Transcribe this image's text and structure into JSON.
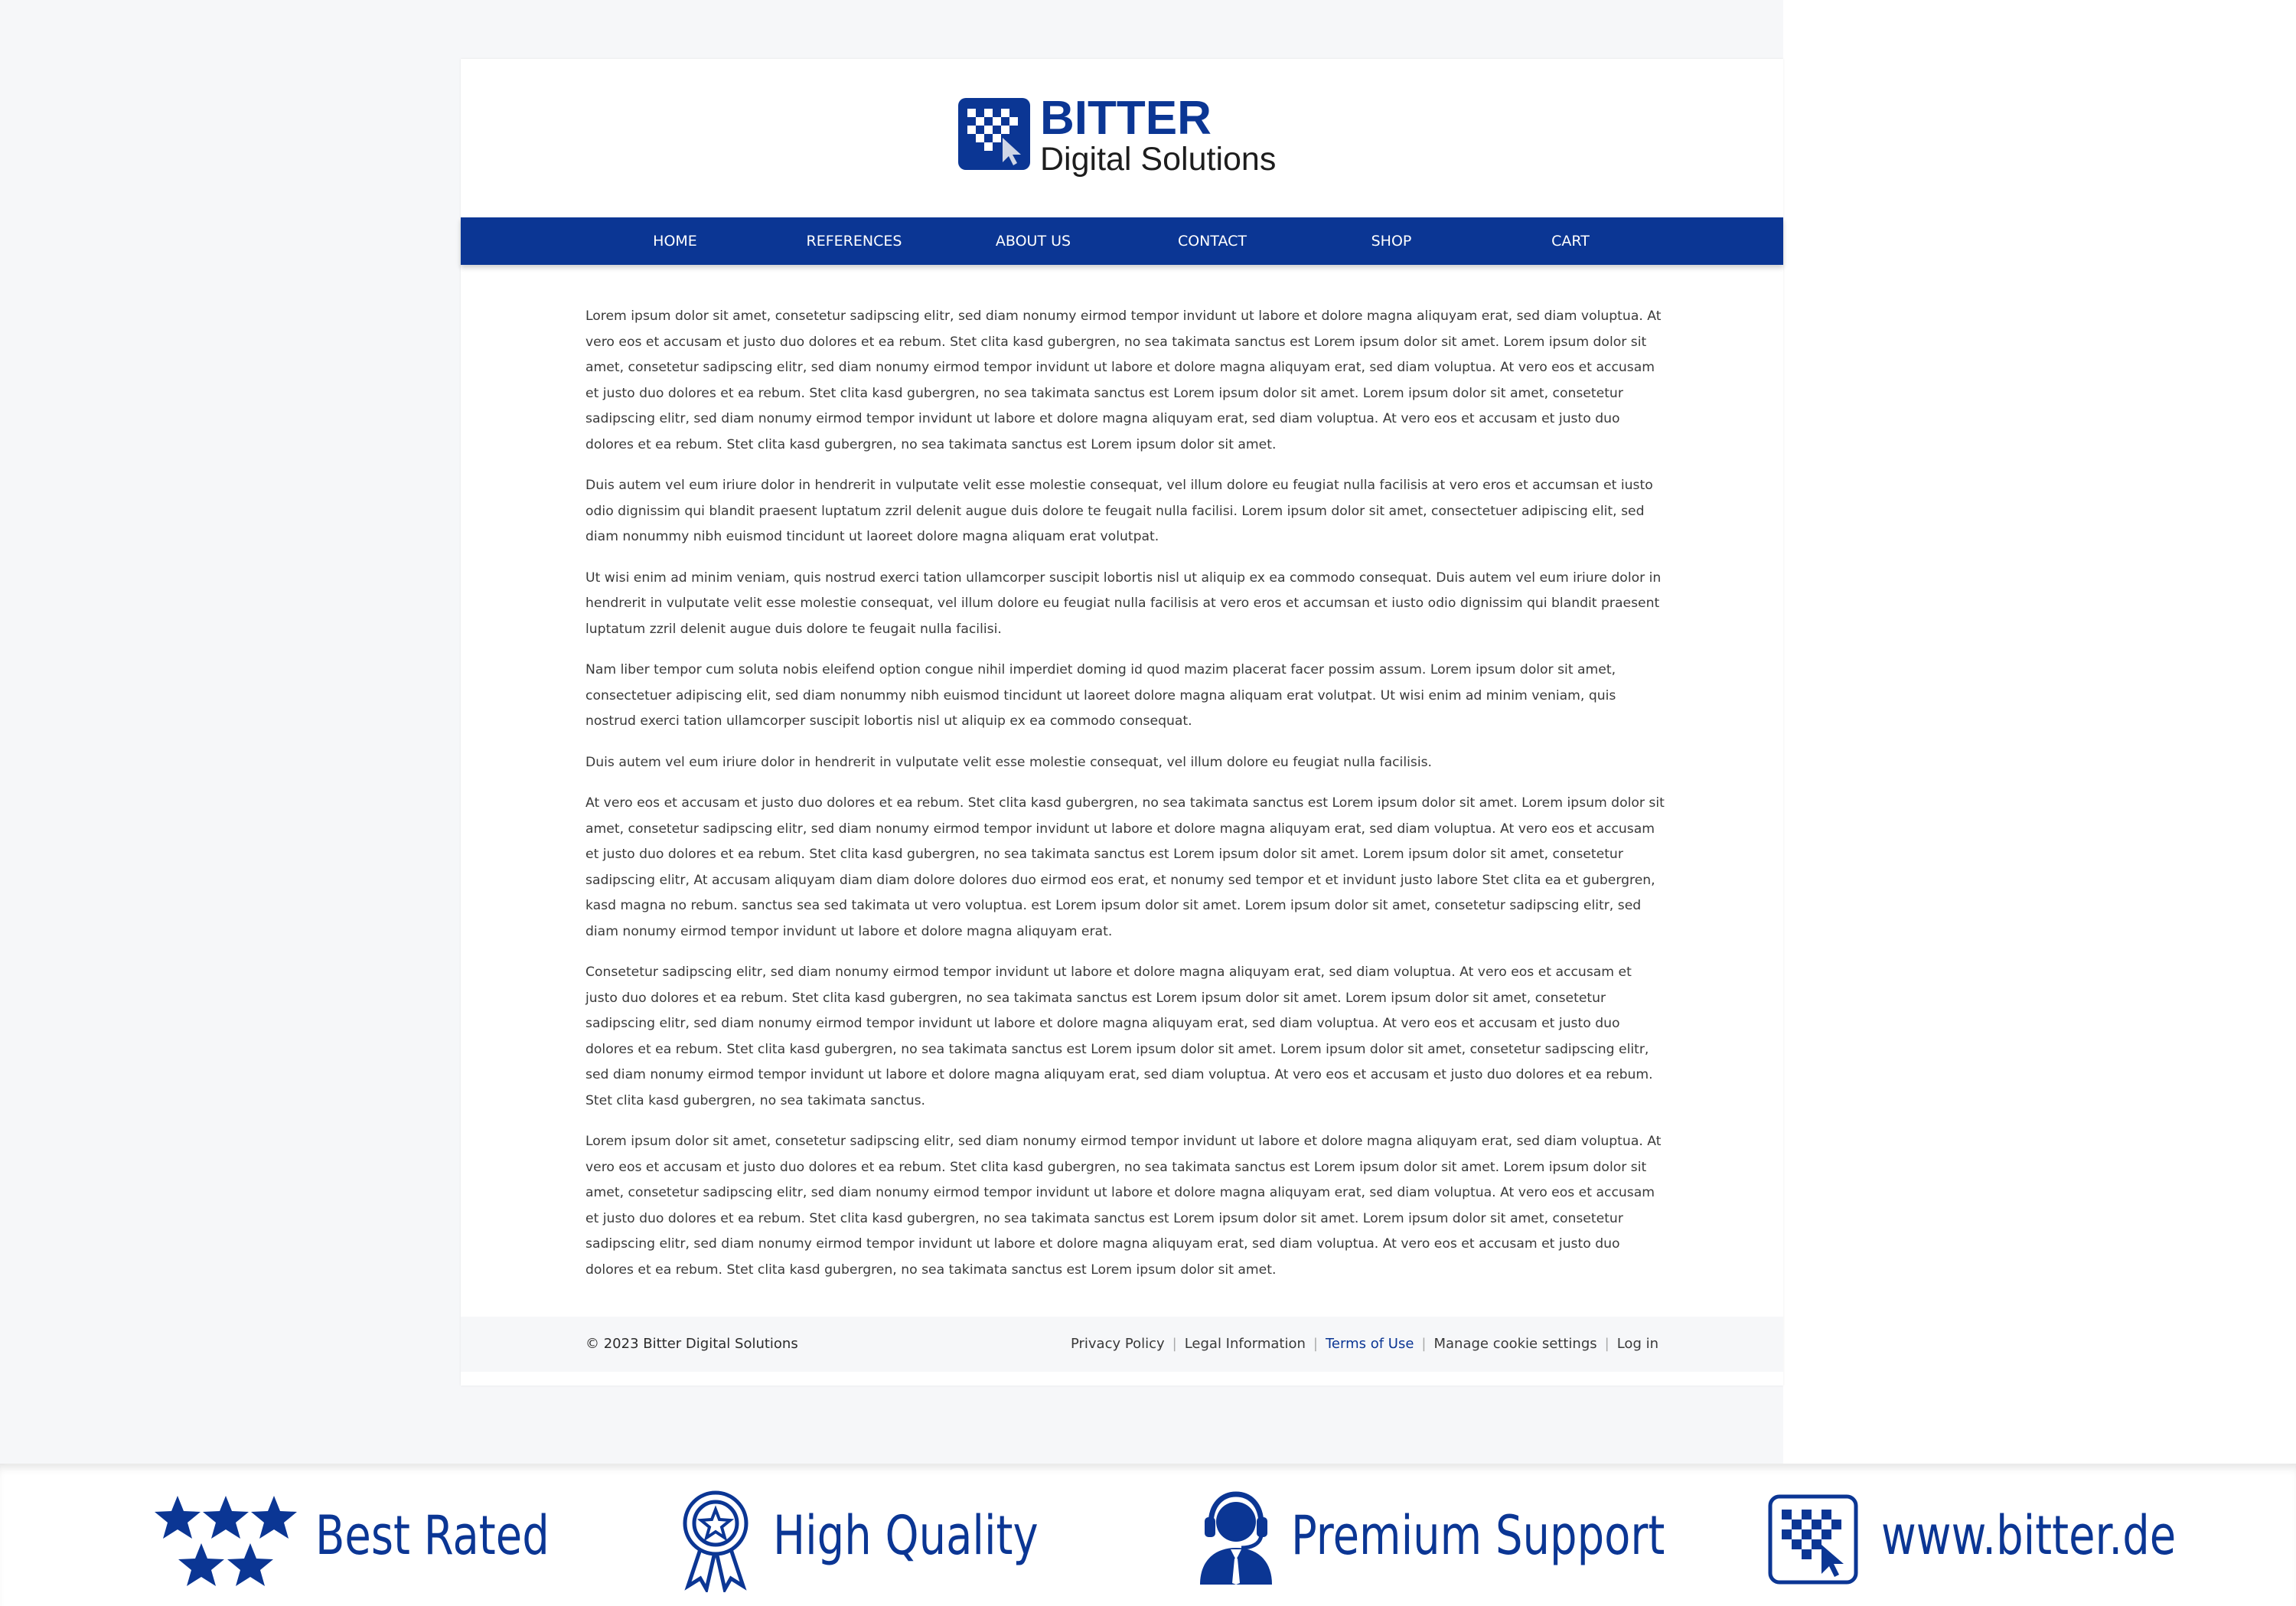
{
  "brand": {
    "name": "BITTER",
    "subtitle": "Digital Solutions",
    "color": "#0b3694"
  },
  "nav": {
    "items": [
      "HOME",
      "REFERENCES",
      "ABOUT US",
      "CONTACT",
      "SHOP",
      "CART"
    ]
  },
  "content": {
    "paragraphs": [
      "Lorem ipsum dolor sit amet, consetetur sadipscing elitr, sed diam nonumy eirmod tempor invidunt ut labore et dolore magna aliquyam erat, sed diam voluptua. At vero eos et accusam et justo duo dolores et ea rebum. Stet clita kasd gubergren, no sea takimata sanctus est Lorem ipsum dolor sit amet. Lorem ipsum dolor sit amet, consetetur sadipscing elitr, sed diam nonumy eirmod tempor invidunt ut labore et dolore magna aliquyam erat, sed diam voluptua. At vero eos et accusam et justo duo dolores et ea rebum. Stet clita kasd gubergren, no sea takimata sanctus est Lorem ipsum dolor sit amet. Lorem ipsum dolor sit amet, consetetur sadipscing elitr, sed diam nonumy eirmod tempor invidunt ut labore et dolore magna aliquyam erat, sed diam voluptua. At vero eos et accusam et justo duo dolores et ea rebum. Stet clita kasd gubergren, no sea takimata sanctus est Lorem ipsum dolor sit amet.",
      "Duis autem vel eum iriure dolor in hendrerit in vulputate velit esse molestie consequat, vel illum dolore eu feugiat nulla facilisis at vero eros et accumsan et iusto odio dignissim qui blandit praesent luptatum zzril delenit augue duis dolore te feugait nulla facilisi. Lorem ipsum dolor sit amet, consectetuer adipiscing elit, sed diam nonummy nibh euismod tincidunt ut laoreet dolore magna aliquam erat volutpat.",
      "Ut wisi enim ad minim veniam, quis nostrud exerci tation ullamcorper suscipit lobortis nisl ut aliquip ex ea commodo consequat. Duis autem vel eum iriure dolor in hendrerit in vulputate velit esse molestie consequat, vel illum dolore eu feugiat nulla facilisis at vero eros et accumsan et iusto odio dignissim qui blandit praesent luptatum zzril delenit augue duis dolore te feugait nulla facilisi.",
      "Nam liber tempor cum soluta nobis eleifend option congue nihil imperdiet doming id quod mazim placerat facer possim assum. Lorem ipsum dolor sit amet, consectetuer adipiscing elit, sed diam nonummy nibh euismod tincidunt ut laoreet dolore magna aliquam erat volutpat. Ut wisi enim ad minim veniam, quis nostrud exerci tation ullamcorper suscipit lobortis nisl ut aliquip ex ea commodo consequat.",
      "Duis autem vel eum iriure dolor in hendrerit in vulputate velit esse molestie consequat, vel illum dolore eu feugiat nulla facilisis.",
      "At vero eos et accusam et justo duo dolores et ea rebum. Stet clita kasd gubergren, no sea takimata sanctus est Lorem ipsum dolor sit amet. Lorem ipsum dolor sit amet, consetetur sadipscing elitr, sed diam nonumy eirmod tempor invidunt ut labore et dolore magna aliquyam erat, sed diam voluptua. At vero eos et accusam et justo duo dolores et ea rebum. Stet clita kasd gubergren, no sea takimata sanctus est Lorem ipsum dolor sit amet. Lorem ipsum dolor sit amet, consetetur sadipscing elitr, At accusam aliquyam diam diam dolore dolores duo eirmod eos erat, et nonumy sed tempor et et invidunt justo labore Stet clita ea et gubergren, kasd magna no rebum. sanctus sea sed takimata ut vero voluptua. est Lorem ipsum dolor sit amet. Lorem ipsum dolor sit amet, consetetur sadipscing elitr, sed diam nonumy eirmod tempor invidunt ut labore et dolore magna aliquyam erat.",
      "Consetetur sadipscing elitr, sed diam nonumy eirmod tempor invidunt ut labore et dolore magna aliquyam erat, sed diam voluptua. At vero eos et accusam et justo duo dolores et ea rebum. Stet clita kasd gubergren, no sea takimata sanctus est Lorem ipsum dolor sit amet. Lorem ipsum dolor sit amet, consetetur sadipscing elitr, sed diam nonumy eirmod tempor invidunt ut labore et dolore magna aliquyam erat, sed diam voluptua. At vero eos et accusam et justo duo dolores et ea rebum. Stet clita kasd gubergren, no sea takimata sanctus est Lorem ipsum dolor sit amet. Lorem ipsum dolor sit amet, consetetur sadipscing elitr, sed diam nonumy eirmod tempor invidunt ut labore et dolore magna aliquyam erat, sed diam voluptua. At vero eos et accusam et justo duo dolores et ea rebum. Stet clita kasd gubergren, no sea takimata sanctus.",
      "Lorem ipsum dolor sit amet, consetetur sadipscing elitr, sed diam nonumy eirmod tempor invidunt ut labore et dolore magna aliquyam erat, sed diam voluptua. At vero eos et accusam et justo duo dolores et ea rebum. Stet clita kasd gubergren, no sea takimata sanctus est Lorem ipsum dolor sit amet. Lorem ipsum dolor sit amet, consetetur sadipscing elitr, sed diam nonumy eirmod tempor invidunt ut labore et dolore magna aliquyam erat, sed diam voluptua. At vero eos et accusam et justo duo dolores et ea rebum. Stet clita kasd gubergren, no sea takimata sanctus est Lorem ipsum dolor sit amet. Lorem ipsum dolor sit amet, consetetur sadipscing elitr, sed diam nonumy eirmod tempor invidunt ut labore et dolore magna aliquyam erat, sed diam voluptua. At vero eos et accusam et justo duo dolores et ea rebum. Stet clita kasd gubergren, no sea takimata sanctus est Lorem ipsum dolor sit amet."
    ]
  },
  "footer": {
    "copyright": "© 2023 Bitter Digital Solutions",
    "links": [
      "Privacy Policy",
      "Legal Information",
      "Terms of Use",
      "Manage cookie settings",
      "Log in"
    ]
  },
  "banner": {
    "badges": [
      {
        "label": "Best Rated",
        "icon": "stars-icon"
      },
      {
        "label": "High Quality",
        "icon": "award-ribbon-icon"
      },
      {
        "label": "Premium Support",
        "icon": "headset-agent-icon"
      },
      {
        "label": "www.bitter.de",
        "icon": "bitter-logo-icon"
      }
    ]
  }
}
